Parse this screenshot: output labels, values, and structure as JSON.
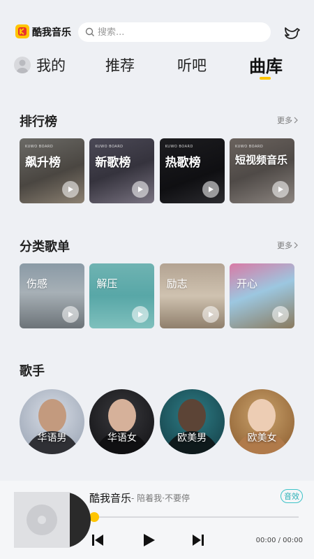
{
  "header": {
    "brand": "酷我音乐",
    "search_placeholder": "搜索..."
  },
  "tabs": [
    {
      "label": "我的"
    },
    {
      "label": "推荐"
    },
    {
      "label": "听吧"
    },
    {
      "label": "曲库",
      "active": true
    }
  ],
  "rankings": {
    "title": "排行榜",
    "more": "更多",
    "items": [
      {
        "board": "KUWO BOARD",
        "label": "飙升榜"
      },
      {
        "board": "KUWO BOARD",
        "label": "新歌榜"
      },
      {
        "board": "KUWO BOARD",
        "label": "热歌榜"
      },
      {
        "board": "KUWO BOARD",
        "label": "短视频音乐"
      }
    ]
  },
  "categories": {
    "title": "分类歌单",
    "more": "更多",
    "items": [
      {
        "label": "伤感"
      },
      {
        "label": "解压"
      },
      {
        "label": "励志"
      },
      {
        "label": "开心"
      }
    ]
  },
  "singers": {
    "title": "歌手",
    "items": [
      {
        "label": "华语男"
      },
      {
        "label": "华语女"
      },
      {
        "label": "欧美男"
      },
      {
        "label": "欧美女"
      }
    ]
  },
  "player": {
    "app_name": "酷我音乐",
    "subtitle": "- 陪着我·不要停",
    "effect_label": "音效",
    "progress": 0,
    "time": "00:00 / 00:00"
  },
  "colors": {
    "accent": "#ffc500",
    "effect": "#3ec3c8"
  }
}
